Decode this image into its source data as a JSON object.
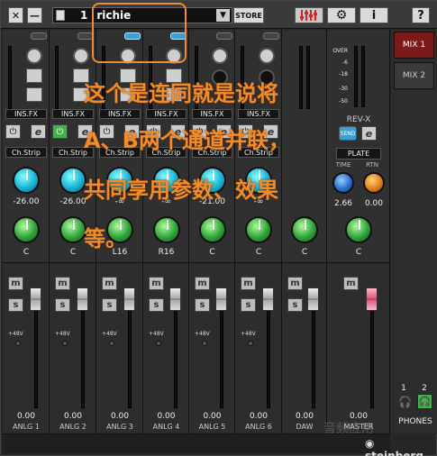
{
  "topbar": {
    "close_label": "✕",
    "minimize_label": "—",
    "preset_number": "1",
    "preset_name": "richie",
    "store_label": "STORE",
    "info_label": "i",
    "help_label": "?"
  },
  "channels": [
    {
      "name": "ANLG 1",
      "insfx": "INS.FX",
      "chstrip": "Ch.Strip",
      "gain": "-26.00",
      "pan": "C",
      "level": "0.00",
      "power_on": false
    },
    {
      "name": "ANLG 2",
      "insfx": "INS.FX",
      "chstrip": "Ch.Strip",
      "gain": "-26.00",
      "pan": "C",
      "level": "0.00",
      "power_on": true
    },
    {
      "name": "ANLG 3",
      "insfx": "INS.FX",
      "chstrip": "Ch.Strip",
      "gain": "-∞",
      "pan": "L16",
      "level": "0.00",
      "power_on": false
    },
    {
      "name": "ANLG 4",
      "insfx": "INS.FX",
      "chstrip": "Ch.Strip",
      "gain": "-∞",
      "pan": "R16",
      "level": "0.00",
      "power_on": false
    },
    {
      "name": "ANLG 5",
      "insfx": "INS.FX",
      "chstrip": "Ch.Strip",
      "gain": "-21.00",
      "pan": "C",
      "level": "0.00",
      "power_on": false
    },
    {
      "name": "ANLG 6",
      "insfx": "INS.FX",
      "chstrip": "Ch.Strip",
      "gain": "-∞",
      "pan": "C",
      "level": "0.00",
      "power_on": false
    },
    {
      "name": "DAW",
      "insfx": "",
      "chstrip": "",
      "gain": "",
      "pan": "C",
      "level": "0.00",
      "power_on": false
    }
  ],
  "p48_label": "+48V",
  "master": {
    "name": "MASTER",
    "meter_scale": [
      "OVER",
      "-6",
      "-18",
      "-30",
      "-50"
    ],
    "revx_label": "REV-X",
    "send_label": "SEND",
    "plate_label": "PLATE",
    "time_label": "TIME",
    "rtn_label": "RTN",
    "time_value": "2.66",
    "rtn_value": "0.00",
    "pan": "C",
    "level": "0.00"
  },
  "mix": {
    "mix1": "MIX 1",
    "mix2": "MIX 2"
  },
  "phones": {
    "label": "PHONES",
    "ch1": "1",
    "ch2": "2"
  },
  "ms": {
    "mute": "m",
    "solo": "s"
  },
  "overlay": {
    "line1": "这个是连同就是说将",
    "line2": "A、B两个通道并联，",
    "line3": "共同享用参数、效果",
    "line4": "等。"
  },
  "brand": "steinberg",
  "watermark": "音频应用"
}
